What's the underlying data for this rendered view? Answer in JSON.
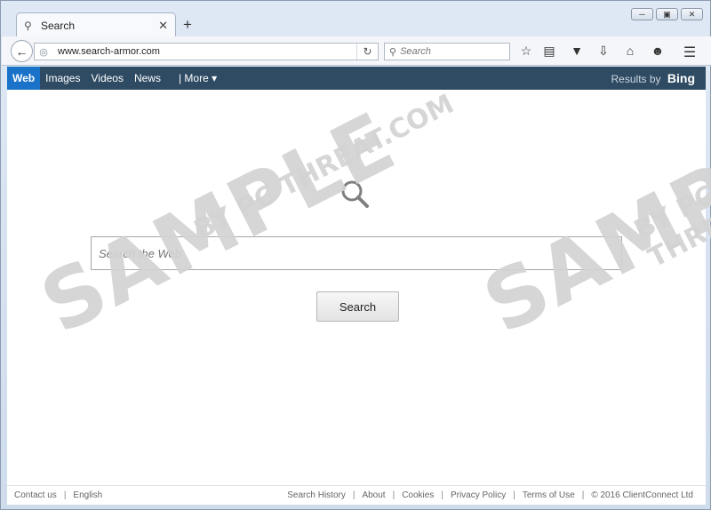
{
  "browser": {
    "tab_title": "Search",
    "url": "www.search-armor.com",
    "search_placeholder": "Search"
  },
  "bing_bar": {
    "links": [
      "Web",
      "Images",
      "Videos",
      "News",
      "| More ▾"
    ],
    "results_by": "Results by",
    "brand": "Bing"
  },
  "main": {
    "search_placeholder": "Search the Web",
    "search_button": "Search"
  },
  "watermark": {
    "main": "SAMPLE",
    "sub": "BY PC THREAT.COM"
  },
  "footer": {
    "left_links": [
      "Contact us",
      "English"
    ],
    "right_links": [
      "Search History",
      "About",
      "Cookies",
      "Privacy Policy",
      "Terms of Use"
    ],
    "copyright": "© 2016 ClientConnect Ltd"
  },
  "colors": {
    "bing_bar": "#2f4b63",
    "active_tab": "#1a73c8"
  }
}
